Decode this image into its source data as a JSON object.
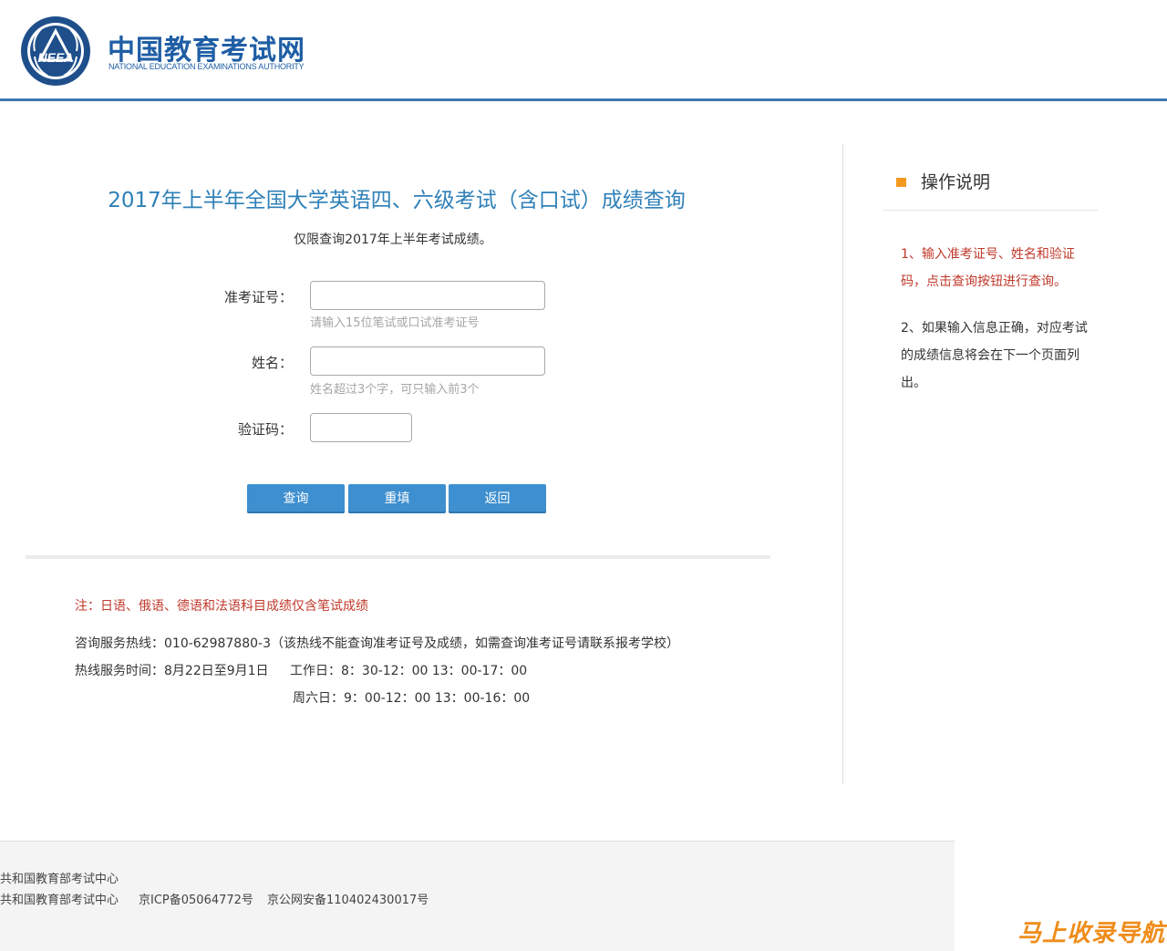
{
  "header": {
    "site_name_cn": "中国教育考试网",
    "site_name_en": "NATIONAL EDUCATION EXAMINATIONS AUTHORITY",
    "emblem_text": "NEEA"
  },
  "main": {
    "title": "2017年上半年全国大学英语四、六级考试（含口试）成绩查询",
    "subtitle": "仅限查询2017年上半年考试成绩。",
    "form": {
      "exam_id_label": "准考证号：",
      "exam_id_value": "",
      "exam_id_hint": "请输入15位笔试或口试准考证号",
      "name_label": "姓名：",
      "name_value": "",
      "name_hint": "姓名超过3个字，可只输入前3个",
      "captcha_label": "验证码：",
      "captcha_value": ""
    },
    "buttons": {
      "query": "查询",
      "reset": "重填",
      "back": "返回"
    },
    "note": "注：日语、俄语、德语和法语科目成绩仅含笔试成绩",
    "hotline": "咨询服务热线：010-62987880-3（该热线不能查询准考证号及成绩，如需查询准考证号请联系报考学校）",
    "hours_label": "热线服务时间：8月22日至9月1日",
    "hours_weekday": "工作日：8：30-12：00 13：00-17：00",
    "hours_saturday": "周六日：9：00-12：00 13：00-16：00"
  },
  "sidebar": {
    "title": "操作说明",
    "step1": "1、输入准考证号、姓名和验证码，点击查询按钮进行查询。",
    "step2": "2、如果输入信息正确，对应考试的成绩信息将会在下一个页面列出。"
  },
  "footer": {
    "line1": "共和国教育部考试中心",
    "line2_org": "共和国教育部考试中心",
    "icp": "京ICP备05064772号",
    "police": "京公网安备110402430017号"
  },
  "watermark": "马上收录导航",
  "colors": {
    "brand_blue": "#1f5ea5",
    "title_blue": "#2f80b8",
    "button_blue": "#3e8fcf",
    "alert_red": "#c0392b",
    "bullet_orange": "#f39a1e"
  }
}
